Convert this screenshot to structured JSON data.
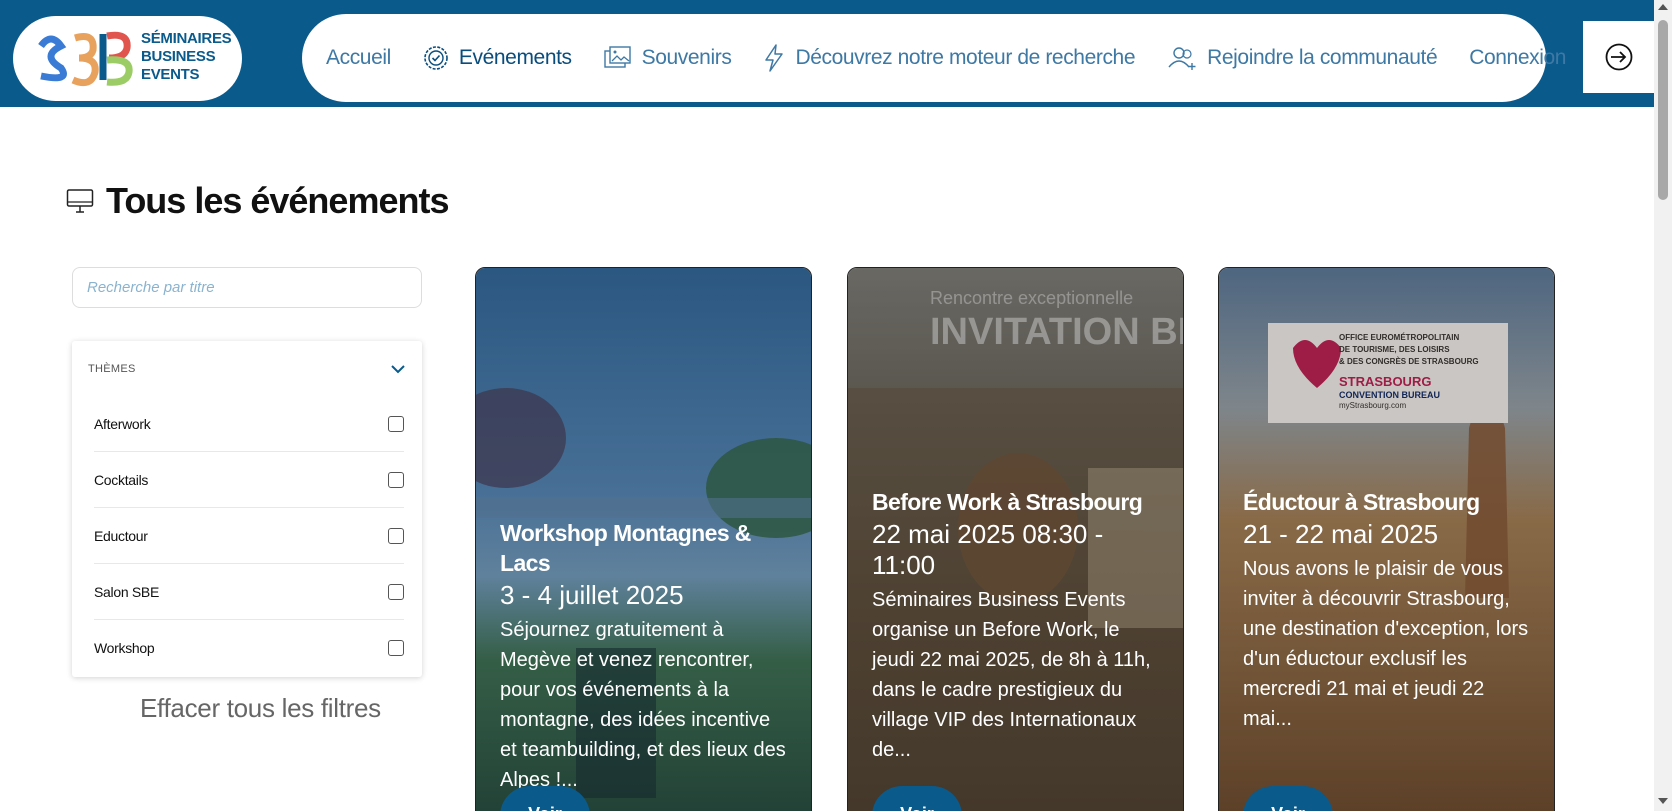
{
  "logo": {
    "mark": "SBE",
    "line1": "SÉMINAIRES",
    "line2": "BUSINESS",
    "line3": "EVENTS"
  },
  "nav": {
    "items": [
      {
        "label": "Accueil",
        "icon": "none"
      },
      {
        "label": "Evénements",
        "icon": "badge-check-icon"
      },
      {
        "label": "Souvenirs",
        "icon": "photos-icon"
      },
      {
        "label": "Découvrez notre moteur de recherche",
        "icon": "bolt-icon"
      },
      {
        "label": "Rejoindre la communauté",
        "icon": "user-plus-icon"
      },
      {
        "label": "Connexion",
        "icon": "none"
      }
    ]
  },
  "page": {
    "title": "Tous les événements"
  },
  "search": {
    "placeholder": "Recherche par titre"
  },
  "filters": {
    "header": "THÈMES",
    "items": [
      "Afterwork",
      "Cocktails",
      "Eductour",
      "Salon SBE",
      "Workshop"
    ],
    "clear_label": "Effacer tous les filtres"
  },
  "cards": [
    {
      "title": "Workshop Montagnes & Lacs",
      "date": "3 - 4 juillet 2025",
      "desc": "Séjournez gratuitement à Megève et venez rencontrer, pour vos événements à la montagne, des idées incentive et teambuilding, et des lieux des Alpes !...",
      "button": "Voir"
    },
    {
      "title": "Before Work à Strasbourg",
      "date": "22 mai 2025 08:30 - 11:00",
      "desc": "Séminaires Business Events organise un Before Work, le jeudi 22 mai 2025, de 8h à 11h, dans le cadre prestigieux du village VIP des Internationaux de...",
      "button": "Voir",
      "image_text": {
        "line1": "Rencontre exceptionnelle",
        "line2": "INVITATION BE"
      }
    },
    {
      "title": "Éductour à Strasbourg",
      "date": "21 - 22 mai 2025",
      "desc": "Nous avons le plaisir de vous inviter à découvrir Strasbourg, une destination d'exception, lors d'un éductour exclusif les mercredi 21 mai et jeudi 22 mai...",
      "button": "Voir",
      "image_text": {
        "line1": "OFFICE EUROMÉTROPOLITAIN",
        "line2": "DE TOURISME, DES LOISIRS",
        "line3": "& DES CONGRÈS DE STRASBOURG",
        "line4": "STRASBOURG",
        "line5": "CONVENTION BUREAU",
        "line6": "myStrasbourg.com"
      }
    }
  ],
  "colors": {
    "brand": "#0a5a8c",
    "nav_text": "#3e78a4"
  }
}
